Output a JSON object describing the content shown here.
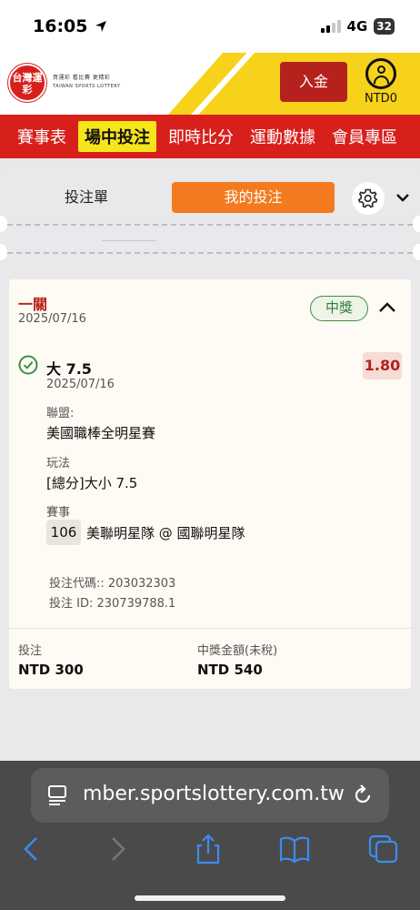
{
  "status_bar": {
    "time": "16:05",
    "network": "4G",
    "battery": "32"
  },
  "header": {
    "logo_mark": "台灣運彩",
    "logo_slogan": "買運彩 看比賽 更精彩",
    "logo_english": "TAIWAN SPORTS LOTTERY",
    "deposit_label": "入金",
    "balance": "NTD0",
    "colors": {
      "brand_red": "#d7201c",
      "brand_yellow": "#f6d21a"
    }
  },
  "nav": {
    "items": [
      "賽事表",
      "場中投注",
      "即時比分",
      "運動數據",
      "會員專區"
    ],
    "active_index": 1
  },
  "tabs": {
    "bet_slip": "投注單",
    "my_bets": "我的投注",
    "settings_icon": "gear-icon",
    "collapse_icon": "chevron-down-icon"
  },
  "bet": {
    "type": "一關",
    "date": "2025/07/16",
    "status": "中獎",
    "selection": {
      "name": "大 7.5",
      "date": "2025/07/16",
      "odds": "1.80",
      "league_label": "聯盟:",
      "league": "美國職棒全明星賽",
      "market_label": "玩法",
      "market": "[總分]大小 7.5",
      "event_label": "賽事",
      "event_no": "106",
      "event": "美聯明星隊 @ 國聯明星隊"
    },
    "bet_code": "投注代碼:: 203032303",
    "bet_id": "投注 ID: 230739788.1",
    "stake_label": "投注",
    "stake": "NTD 300",
    "payout_label": "中獎金額(未稅)",
    "payout": "NTD 540"
  },
  "browser": {
    "url": "mber.sportslottery.com.tw"
  }
}
